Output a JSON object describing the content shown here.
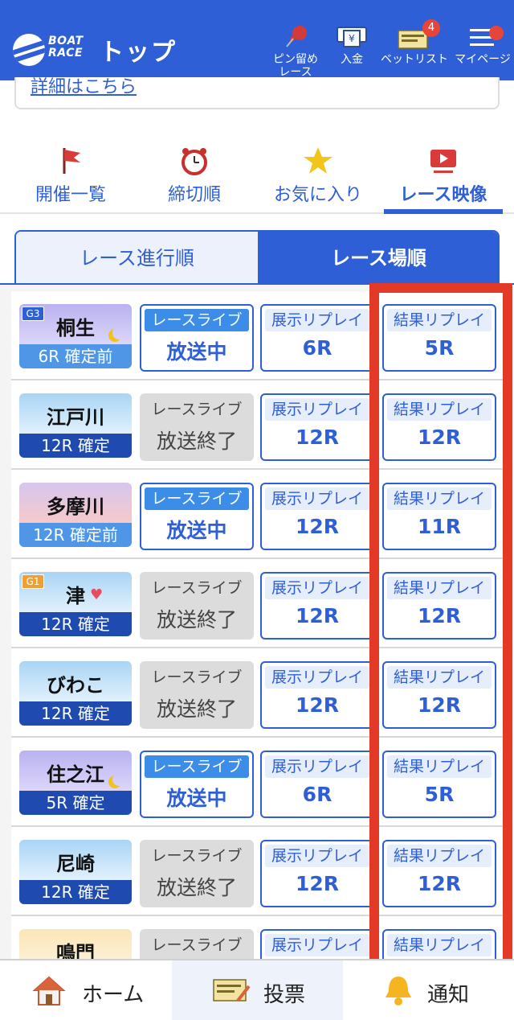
{
  "header": {
    "logo_text": "BOAT RACE",
    "title": "トップ",
    "nav": [
      {
        "label": "ピン留め\nレース",
        "icon": "pin-icon"
      },
      {
        "label": "入金",
        "icon": "deposit-icon"
      },
      {
        "label": "ベットリスト",
        "icon": "betlist-icon",
        "badge": "4"
      },
      {
        "label": "マイページ",
        "icon": "menu-icon"
      }
    ]
  },
  "top_card": {
    "link_text": "詳細はこちら"
  },
  "category_tabs": [
    {
      "label": "開催一覧",
      "icon": "flag-icon"
    },
    {
      "label": "締切順",
      "icon": "alarm-clock-icon"
    },
    {
      "label": "お気に入り",
      "icon": "star-icon"
    },
    {
      "label": "レース映像",
      "icon": "video-icon",
      "active": true
    }
  ],
  "order_toggle": {
    "inactive": "レース進行順",
    "active": "レース場順"
  },
  "button_labels": {
    "live": "レースライブ",
    "exhibition": "展示リプレイ",
    "result": "結果リプレイ"
  },
  "venues": [
    {
      "name": "桐生",
      "grade": "G3",
      "status": "6R 確定前",
      "live": "放送中",
      "live_on": true,
      "ex": "6R",
      "res": "5R"
    },
    {
      "name": "江戸川",
      "status": "12R 確定",
      "live": "放送終了",
      "live_on": false,
      "ex": "12R",
      "res": "12R"
    },
    {
      "name": "多摩川",
      "status": "12R 確定前",
      "live": "放送中",
      "live_on": true,
      "ex": "12R",
      "res": "11R"
    },
    {
      "name": "津",
      "grade": "G1",
      "status": "12R 確定",
      "live": "放送終了",
      "live_on": false,
      "ex": "12R",
      "res": "12R"
    },
    {
      "name": "びわこ",
      "status": "12R 確定",
      "live": "放送終了",
      "live_on": false,
      "ex": "12R",
      "res": "12R"
    },
    {
      "name": "住之江",
      "status": "5R 確定",
      "live": "放送中",
      "live_on": true,
      "ex": "6R",
      "res": "5R"
    },
    {
      "name": "尼崎",
      "status": "12R 確定",
      "live": "放送終了",
      "live_on": false,
      "ex": "12R",
      "res": "12R"
    },
    {
      "name": "鳴門",
      "status": "",
      "live": "",
      "live_on": false,
      "ex": "",
      "res": ""
    }
  ],
  "bottom_nav": [
    {
      "label": "ホーム",
      "icon": "home-icon"
    },
    {
      "label": "投票",
      "icon": "ticket-icon"
    },
    {
      "label": "通知",
      "icon": "bell-icon"
    }
  ],
  "colors": {
    "brand": "#2e5fd6",
    "highlight": "#e23a26",
    "status_dark": "#1f4bb0",
    "status_light": "#4f97e6"
  }
}
